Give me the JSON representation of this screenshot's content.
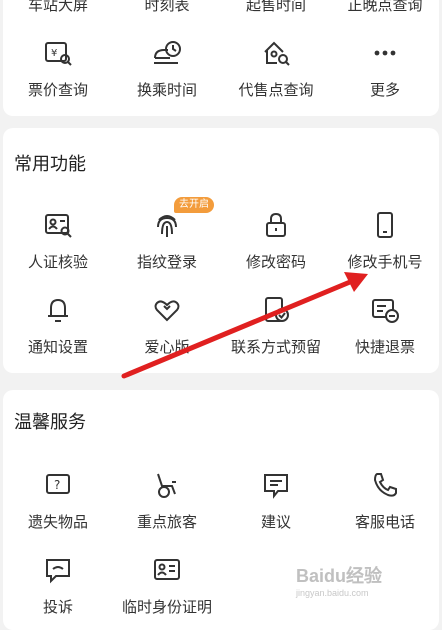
{
  "top_cut_labels": [
    "车站大屏",
    "时刻表",
    "起售时间",
    "正晚点查询"
  ],
  "top_grid": [
    {
      "label": "票价查询",
      "icon": "ticket-price-icon"
    },
    {
      "label": "换乘时间",
      "icon": "train-clock-icon"
    },
    {
      "label": "代售点查询",
      "icon": "home-search-icon"
    },
    {
      "label": "更多",
      "icon": "more-dots-icon"
    }
  ],
  "common": {
    "title": "常用功能",
    "badge": "去开启",
    "items": [
      {
        "label": "人证核验",
        "icon": "id-verify-icon"
      },
      {
        "label": "指纹登录",
        "icon": "fingerprint-icon"
      },
      {
        "label": "修改密码",
        "icon": "lock-icon"
      },
      {
        "label": "修改手机号",
        "icon": "phone-icon"
      },
      {
        "label": "通知设置",
        "icon": "bell-icon"
      },
      {
        "label": "爱心版",
        "icon": "heart-icon"
      },
      {
        "label": "联系方式预留",
        "icon": "contact-reserve-icon"
      },
      {
        "label": "快捷退票",
        "icon": "quick-refund-icon"
      }
    ]
  },
  "service": {
    "title": "温馨服务",
    "items": [
      {
        "label": "遗失物品",
        "icon": "question-box-icon"
      },
      {
        "label": "重点旅客",
        "icon": "wheelchair-icon"
      },
      {
        "label": "建议",
        "icon": "message-icon"
      },
      {
        "label": "客服电话",
        "icon": "phone-call-icon"
      },
      {
        "label": "投诉",
        "icon": "complaint-chat-icon"
      },
      {
        "label": "临时身份证明",
        "icon": "temp-id-icon"
      }
    ]
  },
  "watermark": {
    "main": "Baidu经验",
    "sub": "jingyan.baidu.com"
  },
  "colors": {
    "accent": "#f39c3c",
    "arrow": "#e02020",
    "icon": "#333333"
  }
}
